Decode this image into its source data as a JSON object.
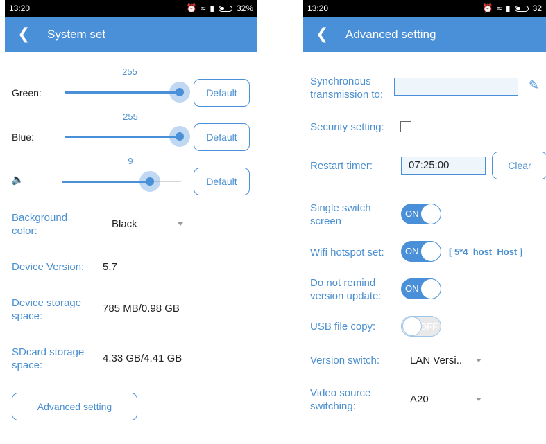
{
  "left": {
    "status": {
      "time": "13:20",
      "battery": "32%"
    },
    "header": {
      "back_icon": "chevron-left-icon",
      "title": "System set"
    },
    "sliders": [
      {
        "label": "Green:",
        "value": "255",
        "button": "Default"
      },
      {
        "label": "Blue:",
        "value": "255",
        "button": "Default"
      },
      {
        "label_icon": "volume-icon",
        "value": "9",
        "button": "Default"
      }
    ],
    "background_color": {
      "label": "Background color:",
      "value": "Black"
    },
    "device_version": {
      "label": "Device Version:",
      "value": "5.7"
    },
    "device_storage": {
      "label": "Device storage space:",
      "value": "785 MB/0.98 GB"
    },
    "sdcard_storage": {
      "label": "SDcard storage space:",
      "value": "4.33 GB/4.41 GB"
    },
    "advanced_button": "Advanced setting",
    "colors": {
      "accent": "#4a90d9"
    }
  },
  "right": {
    "status": {
      "time": "13:20",
      "battery": "32"
    },
    "header": {
      "back_icon": "chevron-left-icon",
      "title": "Advanced setting"
    },
    "sync": {
      "label": "Synchronous transmission to:",
      "value": "",
      "edit_icon": "pencil-icon"
    },
    "security": {
      "label": "Security setting:",
      "checked": false
    },
    "restart": {
      "label": "Restart timer:",
      "value": "07:25:00",
      "button": "Clear"
    },
    "single_switch": {
      "label": "Single switch screen",
      "state": "ON"
    },
    "wifi": {
      "label": "Wifi hotspot set:",
      "state": "ON",
      "hotspot": "[ 5*4_host_Host ]"
    },
    "remind": {
      "label": "Do not remind version update:",
      "state": "ON"
    },
    "usb": {
      "label": "USB file copy:",
      "state": "OFF"
    },
    "version_switch": {
      "label": "Version switch:",
      "value": "LAN Versi.."
    },
    "video_source": {
      "label": "Video source switching:",
      "value": "A20"
    }
  }
}
